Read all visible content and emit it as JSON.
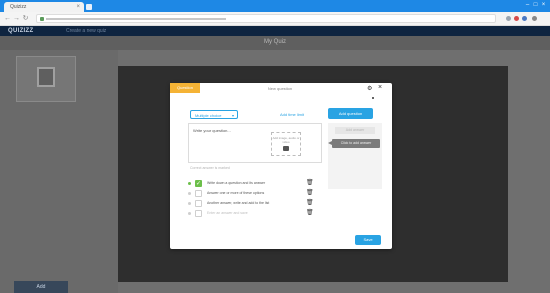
{
  "browser": {
    "tab_title": "Quizizz",
    "tab_close": "×",
    "window_controls": [
      "–",
      "□",
      "×"
    ],
    "nav": {
      "back": "←",
      "forward": "→",
      "reload": "↻"
    },
    "url": ""
  },
  "app": {
    "brand": "QUIZIZZ",
    "header_extra": "Create a new quiz"
  },
  "subheader": {
    "title": "My Quiz"
  },
  "left_panel": {
    "footer_label": "Add"
  },
  "modal": {
    "badge": "Question",
    "title": "New question",
    "question_type": "Multiple choice",
    "link_option": "Add time limit",
    "primary_button": "Add question",
    "side_ghost": "Add answer",
    "tooltip": "Click to add answer",
    "question_placeholder": "Write your question...",
    "media_label": "Add image, audio or video",
    "hint": "Correct answer is marked",
    "answers": [
      {
        "text": "Write down a question and its answer",
        "checked": true,
        "faded": false
      },
      {
        "text": "Answer one or more of these options",
        "checked": false,
        "faded": false
      },
      {
        "text": "Another answer, write and add to the list",
        "checked": false,
        "faded": false
      },
      {
        "text": "Enter an answer and save",
        "checked": false,
        "faded": true
      }
    ],
    "footer_button": "Save"
  },
  "colors": {
    "accent": "#29a3e3",
    "header": "#0e2440",
    "correct": "#6cbf4a",
    "badge": "#f5b335"
  }
}
